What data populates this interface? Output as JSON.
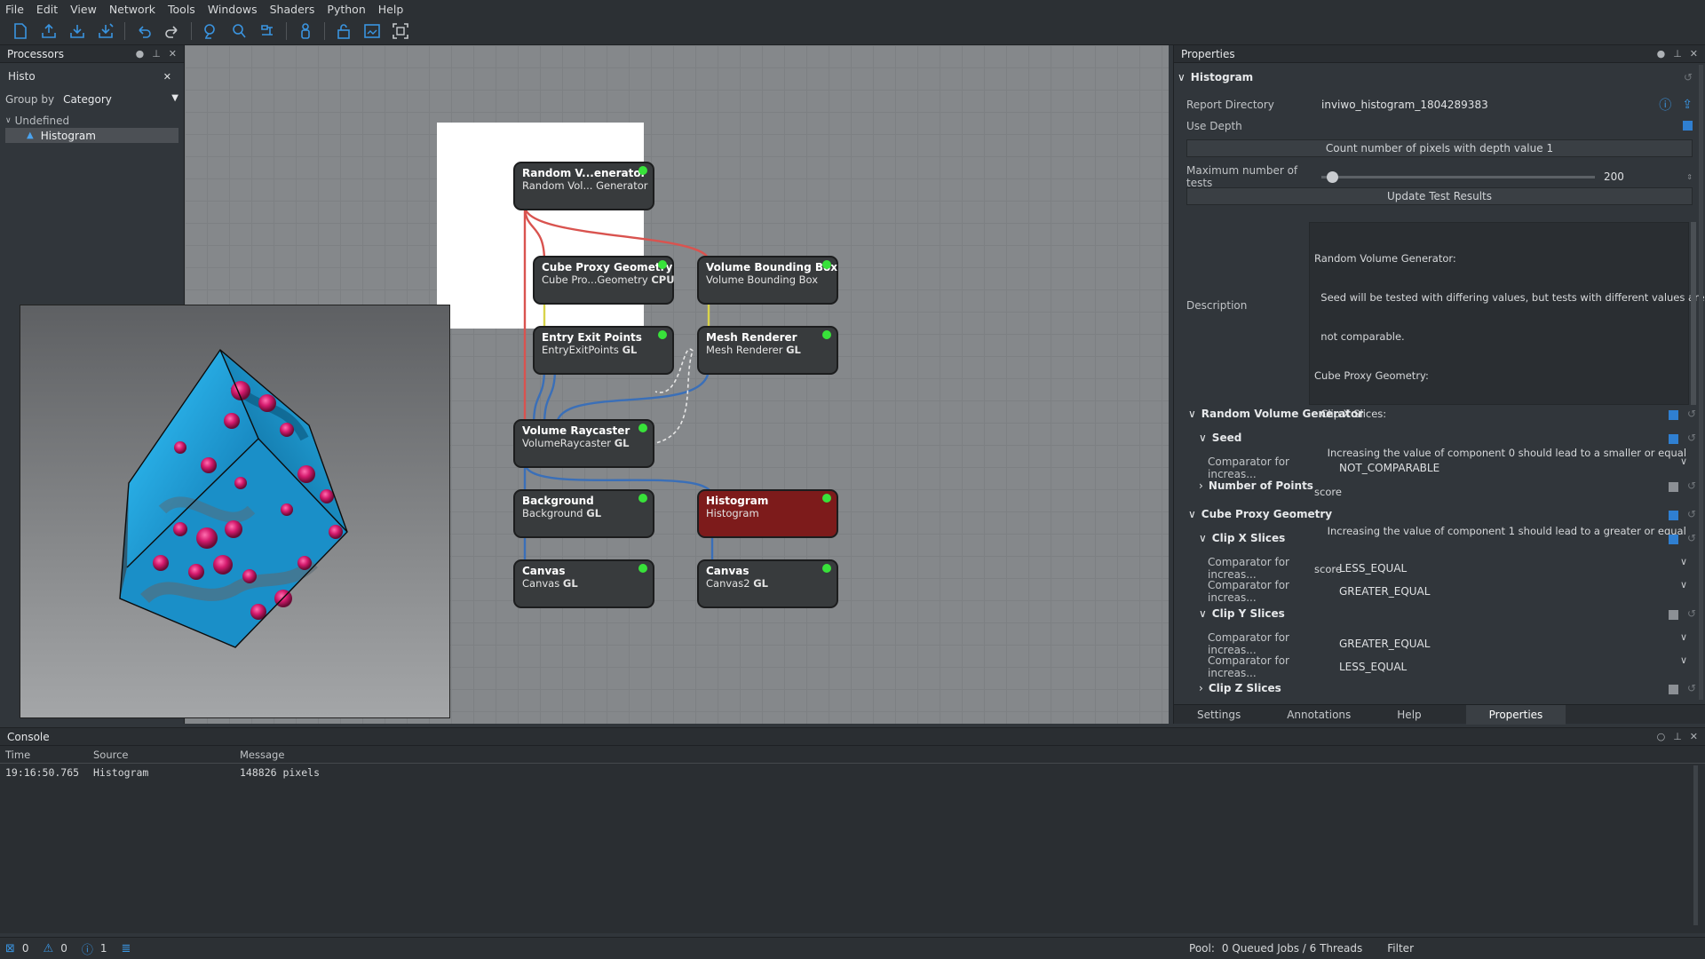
{
  "menu": [
    "File",
    "Edit",
    "View",
    "Network",
    "Tools",
    "Windows",
    "Shaders",
    "Python",
    "Help"
  ],
  "processors": {
    "title": "Processors",
    "search_value": "Histo",
    "group_by_label": "Group by",
    "group_by_value": "Category",
    "tree_category": "Undefined",
    "tree_item": "Histogram"
  },
  "network": {
    "nodes": {
      "random": {
        "title": "Random V...enerator",
        "sub": "Random Vol... Generator",
        "tag": ""
      },
      "cube": {
        "title": "Cube Proxy Geometry",
        "sub": "Cube Pro...Geometry ",
        "tag": "CPU"
      },
      "vbb": {
        "title": "Volume Bounding Box",
        "sub": "Volume Bounding Box",
        "tag": ""
      },
      "entry": {
        "title": "Entry Exit Points",
        "sub": "EntryExitPoints ",
        "tag": "GL"
      },
      "mesh": {
        "title": "Mesh Renderer",
        "sub": "Mesh Renderer ",
        "tag": "GL"
      },
      "raycaster": {
        "title": "Volume Raycaster",
        "sub": "VolumeRaycaster ",
        "tag": "GL"
      },
      "background": {
        "title": "Background",
        "sub": "Background ",
        "tag": "GL"
      },
      "histogram": {
        "title": "Histogram",
        "sub": "Histogram",
        "tag": ""
      },
      "canvas1": {
        "title": "Canvas",
        "sub": "Canvas ",
        "tag": "GL"
      },
      "canvas2": {
        "title": "Canvas",
        "sub": "Canvas2 ",
        "tag": "GL"
      }
    },
    "colors": {
      "node_bg": "#383b3d",
      "selected_node": "#7d1b1b",
      "status_led": "#38e23a",
      "volume_port": "#d9534f",
      "mesh_port": "#d8d34a",
      "image_port": "#3a6fb8"
    }
  },
  "properties": {
    "title": "Properties",
    "processor": "Histogram",
    "report_directory_label": "Report Directory",
    "report_directory_value": "inviwo_histogram_1804289383",
    "use_depth_label": "Use Depth",
    "count_button": "Count number of pixels with depth value 1",
    "max_tests_label": "Maximum number of tests",
    "max_tests_value": "200",
    "max_tests_fraction": 0.02,
    "update_button": "Update Test Results",
    "description_label": "Description",
    "description_lines": [
      "Random Volume Generator:",
      "  Seed will be tested with differing values, but tests with different values are",
      "  not comparable.",
      "Cube Proxy Geometry:",
      "  Clip X Slices:",
      "    Increasing the value of component 0 should lead to a smaller or equal",
      "score",
      "    Increasing the value of component 1 should lead to a greater or equal",
      "score"
    ],
    "sections": {
      "rvg": "Random Volume Generator",
      "seed": "Seed",
      "seed_cmp_label": "Comparator for increas...",
      "seed_cmp_value": "NOT_COMPARABLE",
      "num_points": "Number of Points",
      "cube": "Cube Proxy Geometry",
      "clipx": "Clip X Slices",
      "clipx_1_label": "Comparator for increas...",
      "clipx_1_value": "LESS_EQUAL",
      "clipx_2_label": "Comparator for increas...",
      "clipx_2_value": "GREATER_EQUAL",
      "clipy": "Clip Y Slices",
      "clipy_1_label": "Comparator for increas...",
      "clipy_1_value": "GREATER_EQUAL",
      "clipy_2_label": "Comparator for increas...",
      "clipy_2_value": "LESS_EQUAL",
      "clipz": "Clip Z Slices"
    },
    "tabs": [
      "Settings",
      "Annotations",
      "Help",
      "Properties"
    ]
  },
  "console": {
    "title": "Console",
    "headers": [
      "Time",
      "Source",
      "Message"
    ],
    "rows": [
      {
        "time": "19:16:50.765",
        "source": "Histogram",
        "message": "148826 pixels"
      }
    ]
  },
  "statusbar": {
    "errors": "0",
    "warnings": "0",
    "infos": "1",
    "pool": "Pool:",
    "jobs": "0 Queued Jobs / 6 Threads",
    "filter": "Filter"
  }
}
